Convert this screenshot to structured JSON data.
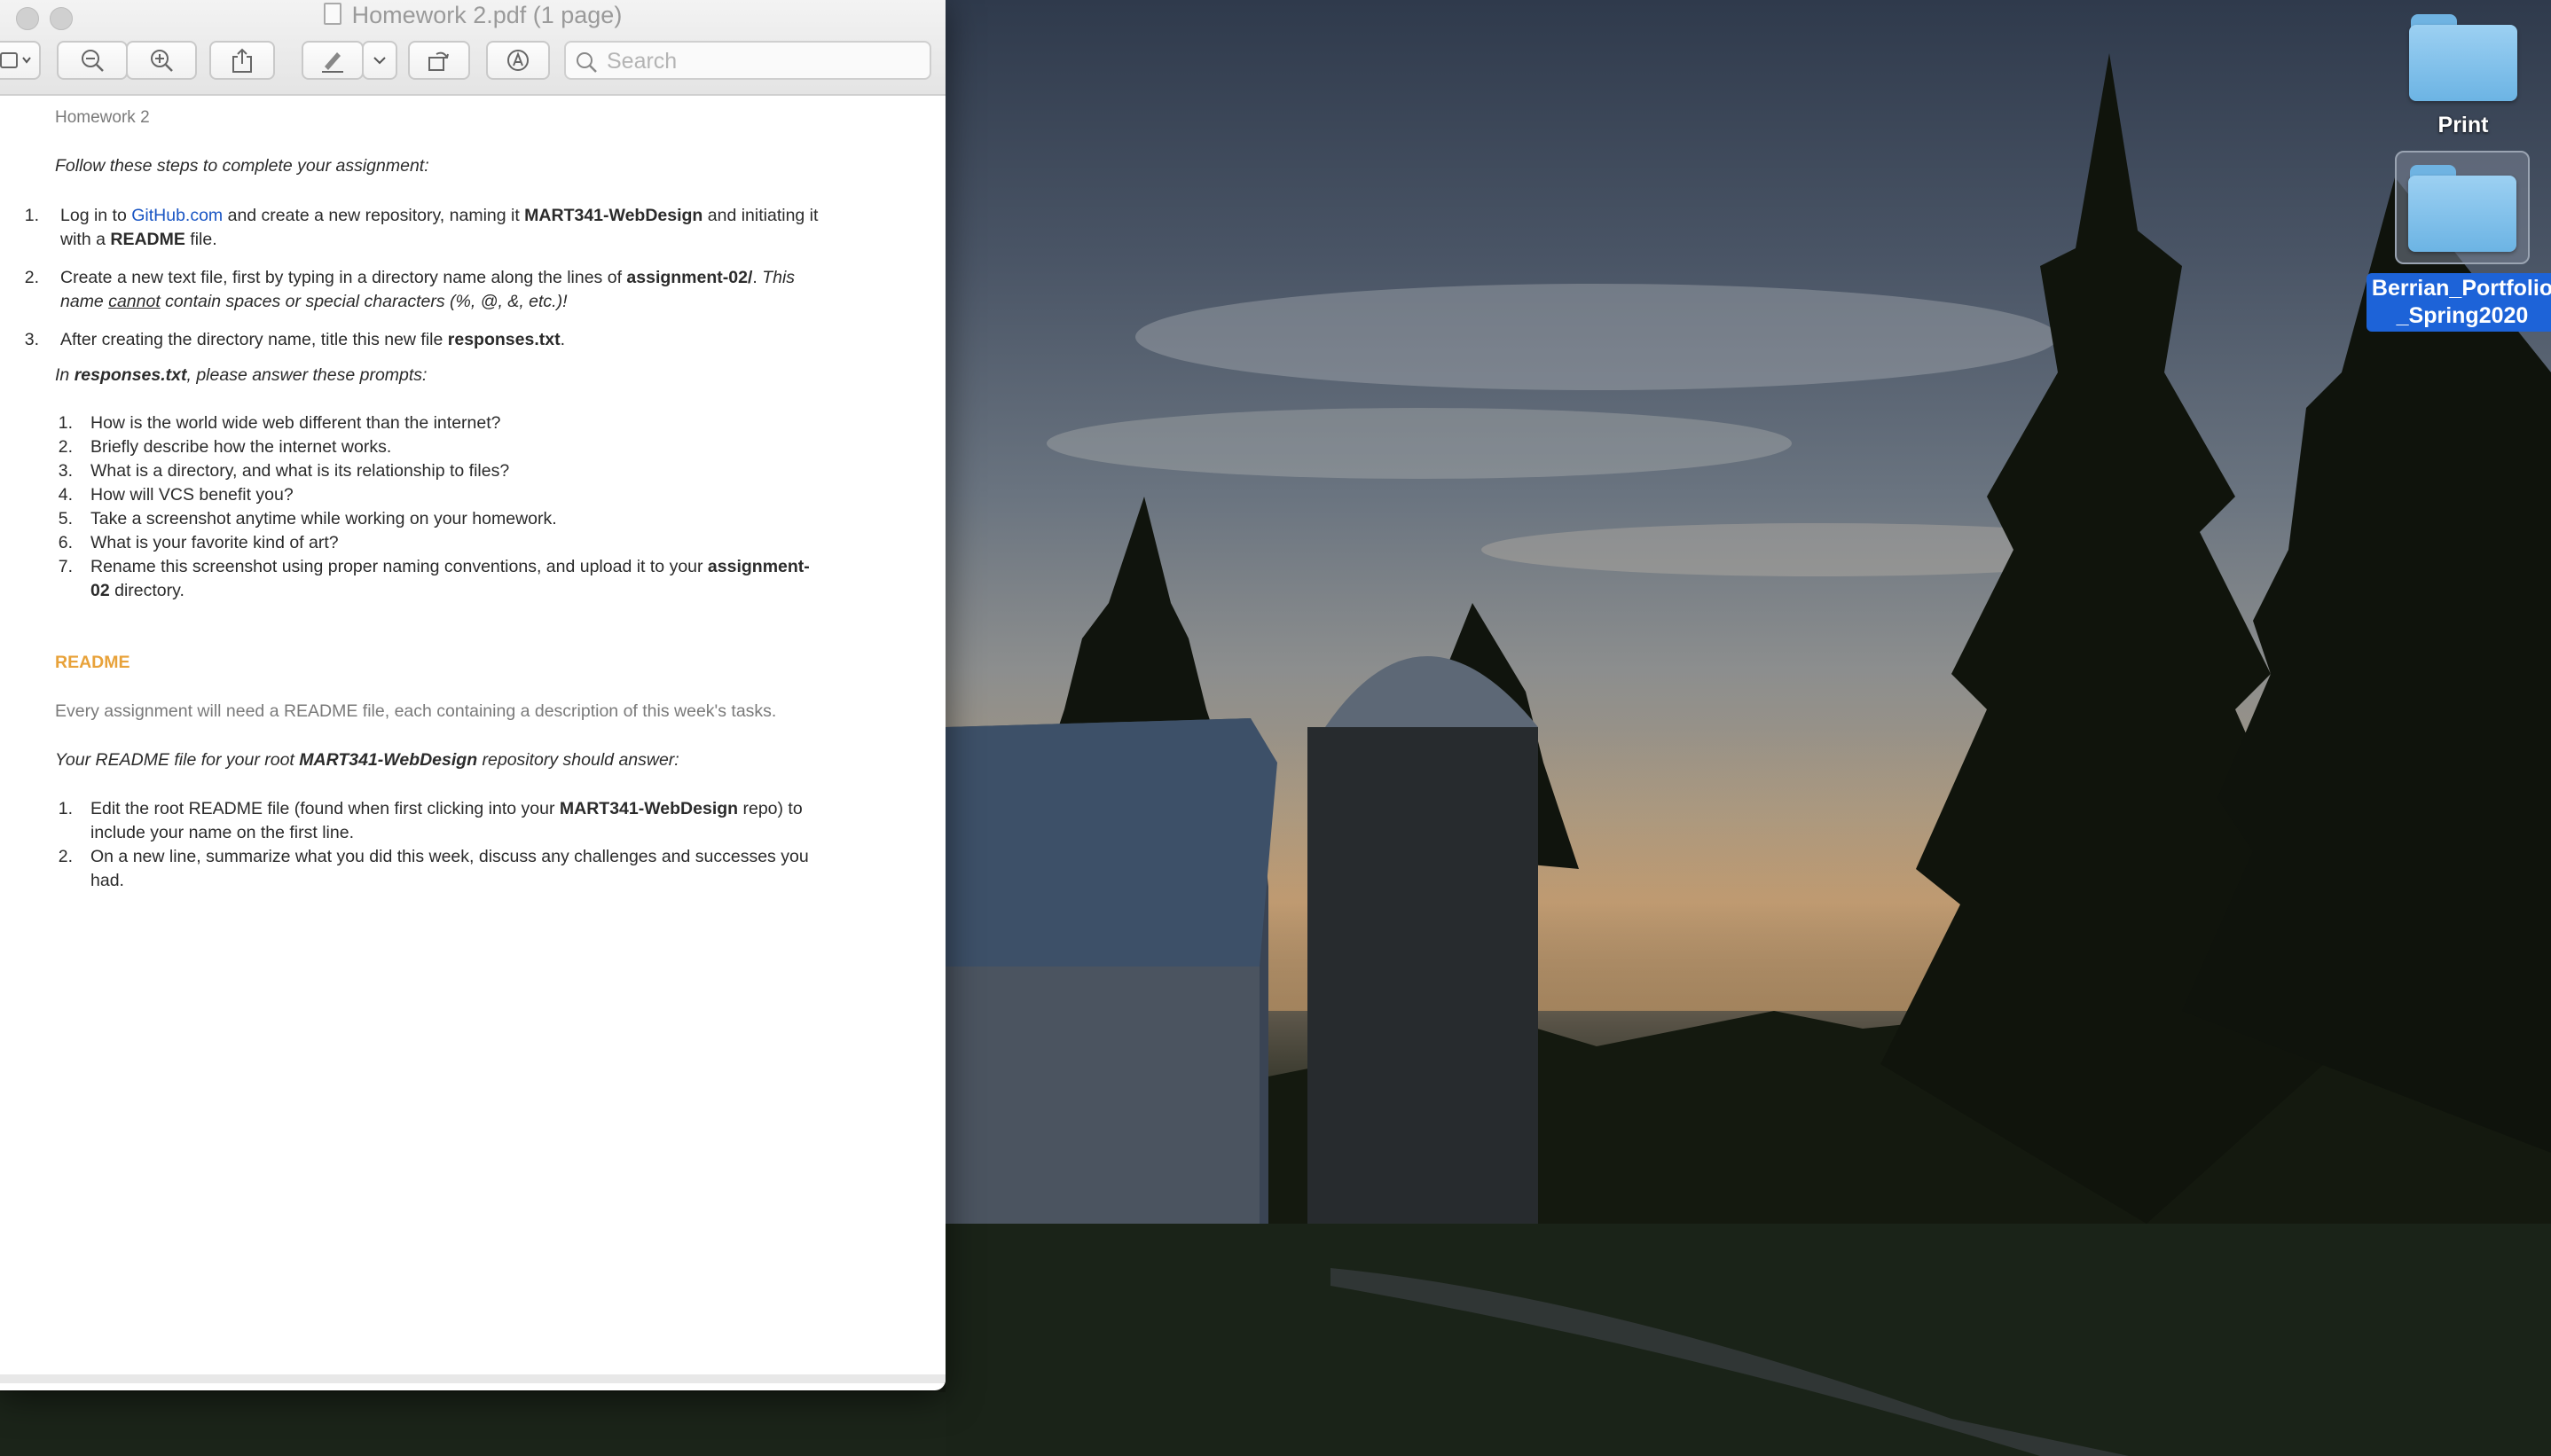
{
  "window": {
    "title": "Homework 2.pdf (1 page)",
    "search_placeholder": "Search"
  },
  "toolbar": {
    "buttons": [
      "sidebar-toggle",
      "zoom-out",
      "zoom-in",
      "share",
      "markup-pen",
      "markup-dropdown",
      "rotate",
      "annotate"
    ]
  },
  "document": {
    "header": "Homework 2",
    "intro": "Follow these steps to complete your assignment:",
    "steps": [
      {
        "n": "1.",
        "a": "Log in to ",
        "link": "GitHub.com",
        "b": " and create a new repository, naming it ",
        "bold1": "MART341-WebDesign",
        "c": " and initiating it",
        "line2a": "with a ",
        "bold2": "README",
        "line2b": " file."
      },
      {
        "n": "2.",
        "a": "Create a new text file, first by typing in a directory name along the lines of ",
        "bold1": "assignment-02/",
        "c": ". ",
        "it1": "This",
        "line2it": "name ",
        "underline": "cannot",
        "line2it2": " contain spaces or special characters (%, @, &, etc.)!"
      },
      {
        "n": "3.",
        "a": "After creating the directory name, title this new file ",
        "bold1": "responses.txt",
        "c": "."
      }
    ],
    "prompts_intro_a": "In ",
    "prompts_intro_bold": "responses.txt",
    "prompts_intro_b": ", please answer these prompts:",
    "prompts": [
      {
        "n": "1.",
        "text": "How is the world wide web different than the internet?"
      },
      {
        "n": "2.",
        "text": "Briefly describe how the internet works."
      },
      {
        "n": "3.",
        "text": "What is a directory, and what is its relationship to files?"
      },
      {
        "n": "4.",
        "text": "How will VCS benefit you?"
      },
      {
        "n": "5.",
        "text": "Take a screenshot anytime while working on your homework."
      },
      {
        "n": "6.",
        "text": "What is your favorite kind of art?"
      },
      {
        "n": "7.",
        "text": "Rename this screenshot using proper naming conventions, and upload it to your ",
        "bold": "assignment-",
        "line2bold": "02",
        "line2": " directory."
      }
    ],
    "readme_heading": "README",
    "readme_desc": "Every assignment will need a README file, each containing a description of this week's tasks.",
    "readme_intro_a": "Your README file for your root ",
    "readme_intro_bold": "MART341-WebDesign",
    "readme_intro_b": " repository should answer:",
    "readme_items": [
      {
        "n": "1.",
        "a": "Edit the root README file (found when first clicking into your ",
        "bold": "MART341-WebDesign",
        "b": " repo) to",
        "line2": "include your name on the first line."
      },
      {
        "n": "2.",
        "a": "On a new line, summarize what you did this week, discuss any challenges and successes you",
        "line2": "had."
      }
    ]
  },
  "desktop": {
    "icons": [
      {
        "label": "Print",
        "selected": false
      },
      {
        "label_line1": "Berrian_Portfolio",
        "label_line2": "_Spring2020",
        "selected": true
      }
    ]
  },
  "colors": {
    "link": "#1a56c4",
    "readme_heading": "#e8a23a",
    "selection": "#1d63d8",
    "folder": "#6cb4e4"
  }
}
